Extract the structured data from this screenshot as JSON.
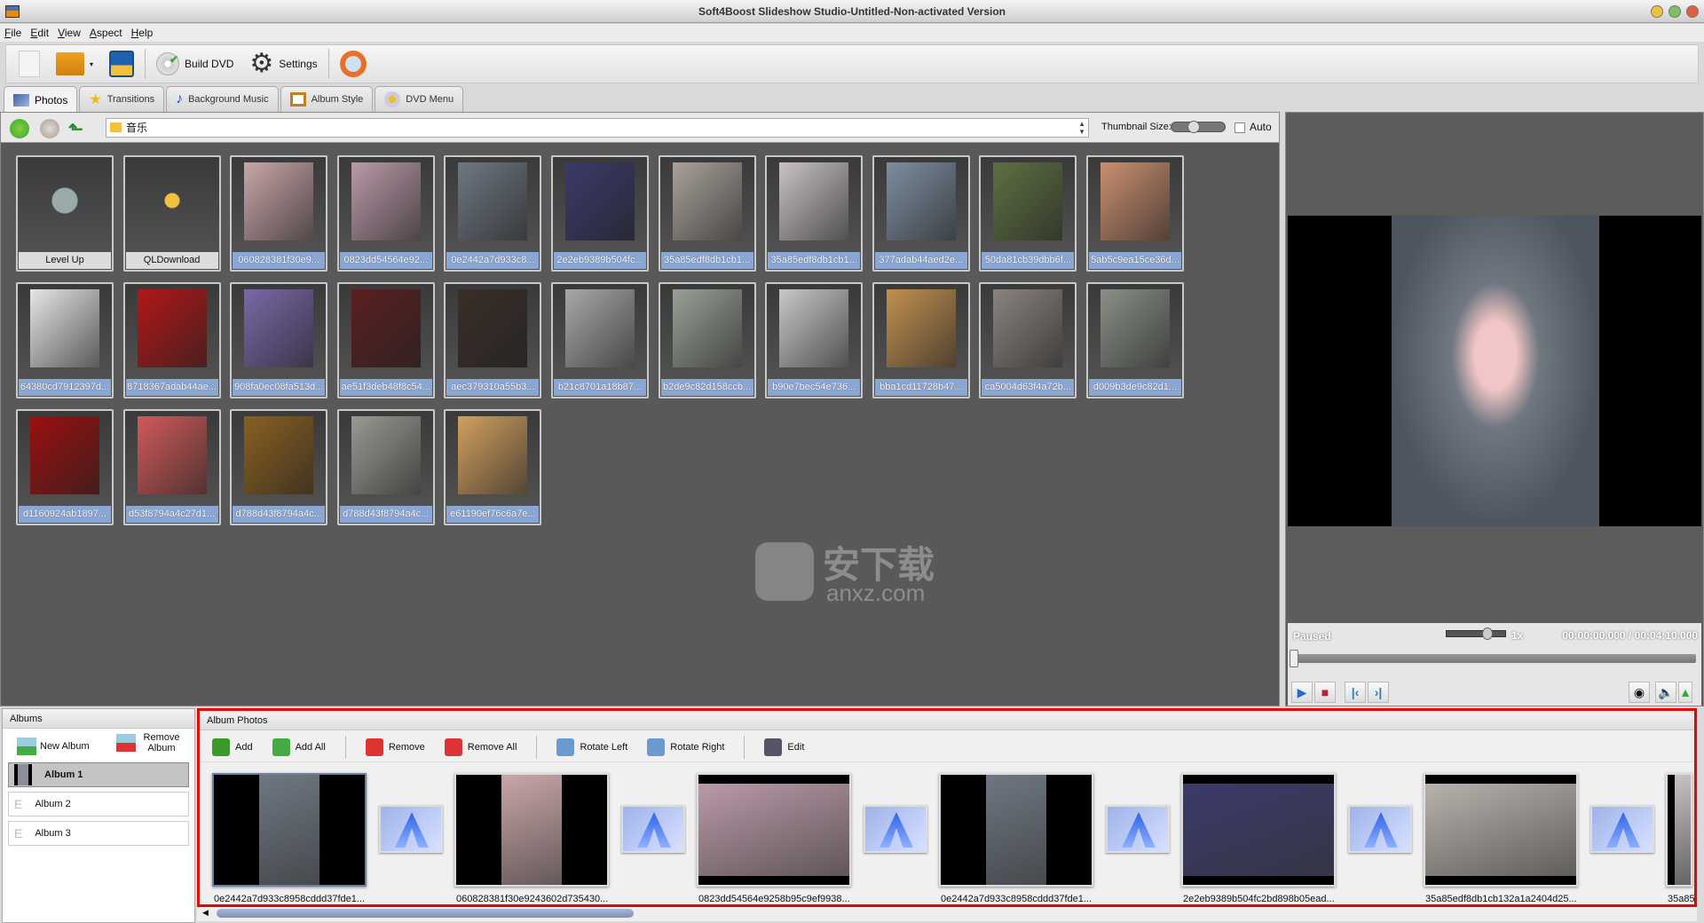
{
  "window": {
    "title": "Soft4Boost Slideshow Studio-Untitled-Non-activated Version"
  },
  "menu": [
    "File",
    "Edit",
    "View",
    "Aspect",
    "Help"
  ],
  "toolbar": {
    "build_dvd": "Build DVD",
    "settings": "Settings"
  },
  "tabs": [
    "Photos",
    "Transitions",
    "Background Music",
    "Album Style",
    "DVD Menu"
  ],
  "browser": {
    "path": "音乐",
    "thumbnail_size_label": "Thumbnail Size:",
    "thumbnail_size_value": 0.35,
    "auto_label": "Auto",
    "auto_checked": false,
    "items": [
      {
        "label": "Level Up",
        "kind": "folder-up"
      },
      {
        "label": "QLDownload",
        "kind": "folder"
      },
      {
        "label": "060828381f30e9...",
        "color": "#c9a6a8"
      },
      {
        "label": "0823dd54564e92...",
        "color": "#b99aa8"
      },
      {
        "label": "0e2442a7d933c8...",
        "color": "#6e7782"
      },
      {
        "label": "2e2eb9389b504fc...",
        "color": "#3b3a6a"
      },
      {
        "label": "35a85edf8db1cb1...",
        "color": "#a9a29a"
      },
      {
        "label": "35a85edf8db1cb1...",
        "color": "#c8c2c4"
      },
      {
        "label": "377adab44aed2e...",
        "color": "#7d8ea0"
      },
      {
        "label": "50da81cb39dbb6f...",
        "color": "#5e7042"
      },
      {
        "label": "5ab5c9ea15ce36d...",
        "color": "#c99070"
      },
      {
        "label": "64380cd7912397d...",
        "color": "#e6e6e6"
      },
      {
        "label": "8718367adab44ae...",
        "color": "#b01818"
      },
      {
        "label": "908fa0ec08fa513d...",
        "color": "#7a68a8"
      },
      {
        "label": "ae51f3deb48f8c54...",
        "color": "#5a2020"
      },
      {
        "label": "aec379310a55b3...",
        "color": "#3a2e28"
      },
      {
        "label": "b21c8701a18b87...",
        "color": "#a8a8a8"
      },
      {
        "label": "b2de9c82d158ccb...",
        "color": "#9aa098"
      },
      {
        "label": "b90e7bec54e736...",
        "color": "#c8c8c8"
      },
      {
        "label": "bba1cd11728b47...",
        "color": "#c09050"
      },
      {
        "label": "ca5004d63f4a72b...",
        "color": "#8a8480"
      },
      {
        "label": "d009b3de9c82d1...",
        "color": "#8a9088"
      },
      {
        "label": "d1160924ab1897...",
        "color": "#9a1010"
      },
      {
        "label": "d53f8794a4c27d1...",
        "color": "#d05a5a"
      },
      {
        "label": "d788d43f8794a4c...",
        "color": "#8a6020"
      },
      {
        "label": "d788d43f8794a4c...",
        "color": "#9a9a94"
      },
      {
        "label": "e61190ef76c6a7e...",
        "color": "#d0a060"
      }
    ]
  },
  "watermark": {
    "text": "安下载",
    "sub": "anxz.com"
  },
  "preview": {
    "status": "Paused",
    "speed": "1x",
    "speed_value": 0.6,
    "time_current": "00:00:00.000",
    "time_total": "00:04:10.000",
    "progress": 0
  },
  "albums": {
    "header": "Albums",
    "new_album": "New Album",
    "remove_album": "Remove Album",
    "items": [
      "Album 1",
      "Album 2",
      "Album 3"
    ],
    "selected": "Album 1"
  },
  "album_photos": {
    "header": "Album Photos",
    "tools": [
      "Add",
      "Add All",
      "Remove",
      "Remove All",
      "Rotate Left",
      "Rotate Right",
      "Edit"
    ],
    "items": [
      {
        "label": "0e2442a7d933c8958cddd37fde1...",
        "color": "#6e7782",
        "portrait": true
      },
      {
        "label": "060828381f30e9243602d735430...",
        "color": "#c9a6a8",
        "portrait": true
      },
      {
        "label": "0823dd54564e9258b95c9ef9938...",
        "color": "#b99aa8",
        "portrait": false
      },
      {
        "label": "0e2442a7d933c8958cddd37fde1...",
        "color": "#6e7782",
        "portrait": true
      },
      {
        "label": "2e2eb9389b504fc2bd898b05ead...",
        "color": "#3b3a6a",
        "portrait": false
      },
      {
        "label": "35a85edf8db1cb132a1a2404d25...",
        "color": "#b8b2ac",
        "portrait": false
      },
      {
        "label": "35a85",
        "color": "#c8c2c4",
        "portrait": true
      }
    ]
  }
}
